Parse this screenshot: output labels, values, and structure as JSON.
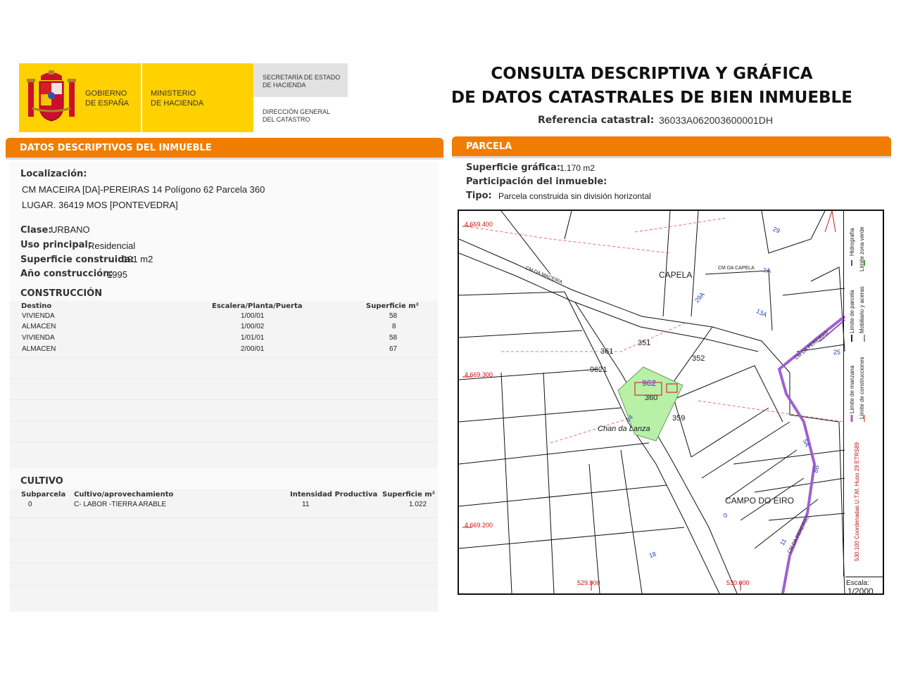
{
  "header": {
    "gov_line1": "GOBIERNO",
    "gov_line2": "DE ESPAÑA",
    "ministry_line1": "MINISTERIO",
    "ministry_line2": "DE HACIENDA",
    "secretaria_line1": "SECRETARÍA DE ESTADO",
    "secretaria_line2": "DE HACIENDA",
    "direccion_line1": "DIRECCIÓN GENERAL",
    "direccion_line2": "DEL CATASTRO",
    "title_line1": "CONSULTA DESCRIPTIVA Y GRÁFICA",
    "title_line2": "DE DATOS CATASTRALES DE BIEN INMUEBLE",
    "ref_label": "Referencia catastral:",
    "ref_value": "36033A062003600001DH",
    "brand_yellow": "#FFD100",
    "accent_orange": "#F07D00"
  },
  "descriptive": {
    "section_title": "DATOS DESCRIPTIVOS DEL INMUEBLE",
    "localizacion_label": "Localización:",
    "localizacion_line1": "CM MACEIRA [DA]-PEREIRAS 14 Polígono 62 Parcela 360",
    "localizacion_line2": "LUGAR. 36419 MOS [PONTEVEDRA]",
    "clase_label": "Clase:",
    "clase_value": "URBANO",
    "uso_label": "Uso principal:",
    "uso_value": "Residencial",
    "superficie_label": "Superficie construida:",
    "superficie_value": "191 m2",
    "anio_label": "Año construcción:",
    "anio_value": "1995"
  },
  "construccion": {
    "title": "CONSTRUCCIÓN",
    "headers": [
      "Destino",
      "Escalera/Planta/Puerta",
      "Superficie m²"
    ],
    "rows": [
      [
        "VIVIENDA",
        "1/00/01",
        "58"
      ],
      [
        "ALMACEN",
        "1/00/02",
        "8"
      ],
      [
        "VIVIENDA",
        "1/01/01",
        "58"
      ],
      [
        "ALMACEN",
        "2/00/01",
        "67"
      ]
    ]
  },
  "cultivo": {
    "title": "CULTIVO",
    "headers": [
      "Subparcela",
      "Cultivo/aprovechamiento",
      "Intensidad Productiva",
      "Superficie m²"
    ],
    "rows": [
      [
        "0",
        "C- LABOR -TIERRA ARABLE",
        "11",
        "1.022"
      ]
    ]
  },
  "parcela": {
    "section_title": "PARCELA",
    "superficie_label": "Superficie gráfica:",
    "superficie_value": "1.170 m2",
    "participacion_label": "Participación del inmueble:",
    "tipo_label": "Tipo:",
    "tipo_value": "Parcela construida sin división horizontal"
  },
  "map": {
    "coords": {
      "y1": "4.669.400",
      "y2": "4.669.300",
      "y3": "4.669.200",
      "x1": "529.900",
      "x2": "530.000"
    },
    "parcel_labels": [
      "351",
      "352",
      "361",
      "360",
      "359",
      "962",
      "9621"
    ],
    "place_labels": {
      "capela": "CAPELA",
      "campo": "CAMPO DO EIRO",
      "chan": "Chan da Lanza",
      "road1": "CM DA MACEIRA",
      "road2": "CM DA CAPELA",
      "road3": "CM DA PEREIRAS",
      "road4": "CM DA PEREIRAS"
    },
    "number_labels": [
      "29",
      "7A",
      "29A",
      "13A",
      "25",
      "5A",
      "8B",
      "0",
      "18",
      "11",
      "14"
    ],
    "scale_label": "Escala:",
    "scale_value": "1/2000",
    "legend": {
      "hidrografia": "Hidrografía",
      "zona_verde": "Límite zona verde",
      "parcela": "Límite de parcela",
      "mobiliario": "Mobiliario y aceras",
      "manzana": "Límite de manzana",
      "construcciones": "Límite de construcciones",
      "coords_note": "530.100 Coordenadas U.T.M. Huso 29 ETRS89"
    },
    "colors": {
      "parcel_fill": "#b8f0a8",
      "road_purple": "#a060d0",
      "coord_red": "#d01010",
      "number_blue": "#2040c0"
    }
  }
}
